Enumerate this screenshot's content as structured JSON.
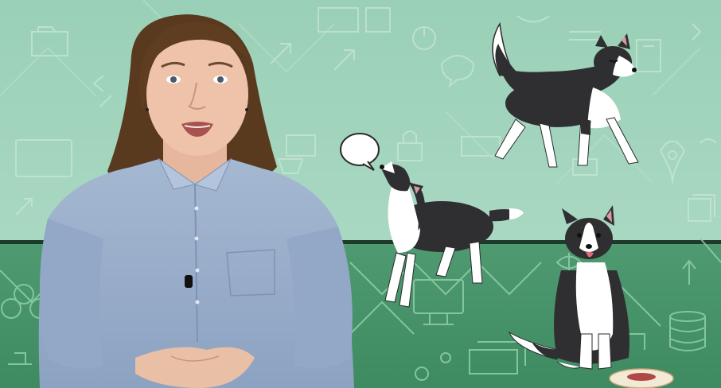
{
  "scene": {
    "description_free": true,
    "colors": {
      "wall_top": "#9fd0b9",
      "wall_bottom": "#4f9a71",
      "divider": "#1e3a2a",
      "line_art_light": "#cfe8dc",
      "line_art_dark": "#9fd7b3",
      "dog_black": "#2f2f31",
      "dog_white": "#ffffff",
      "shirt": "#9fb4cf",
      "hair": "#5a3a1f",
      "skin": "#e9bfa6"
    },
    "elements": {
      "presenter": "person-presenting",
      "dog_walking": "dog-walking",
      "dog_howling": "dog-howling",
      "dog_sitting": "dog-sitting",
      "speech_bubble": "speech-bubble-icon",
      "food_bowl": "food-bowl"
    }
  }
}
